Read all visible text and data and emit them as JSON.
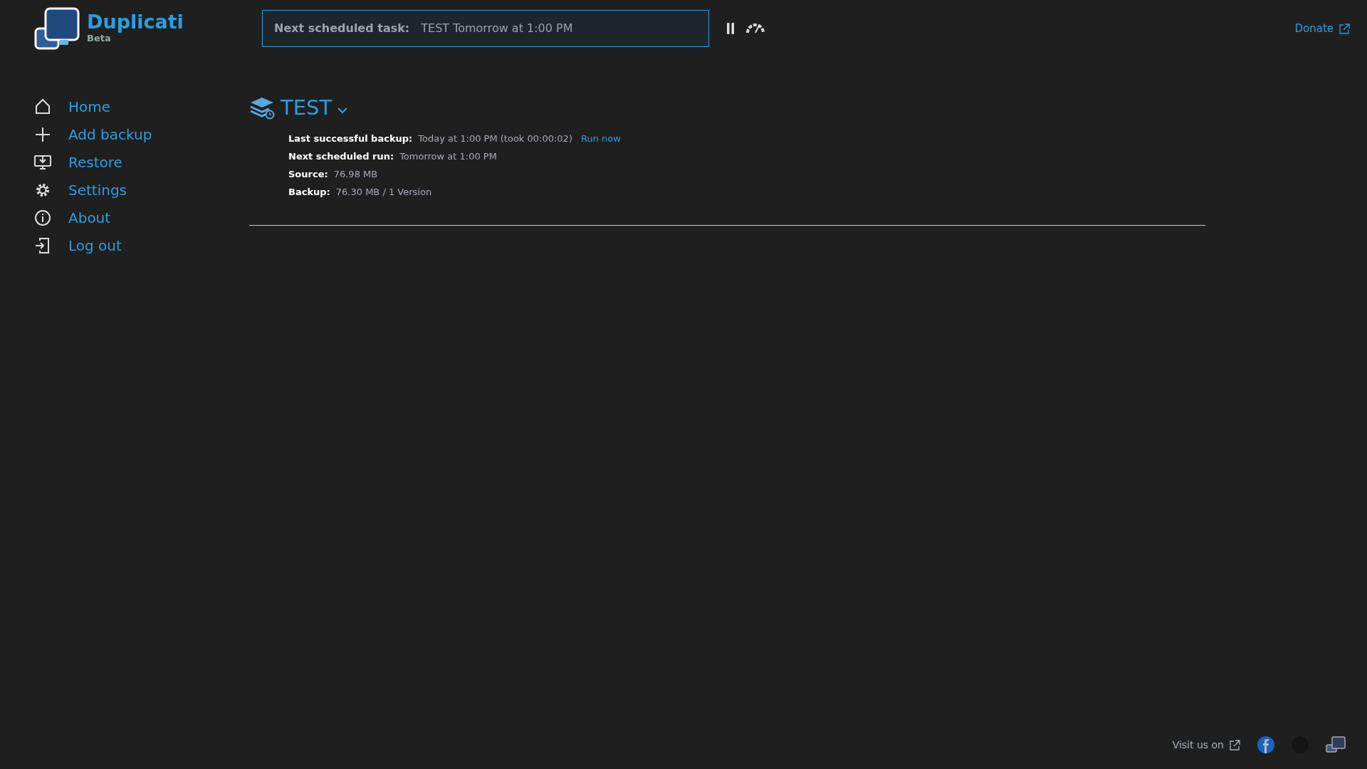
{
  "header": {
    "app_name": "Duplicati",
    "app_edition": "Beta",
    "task_label": "Next scheduled task:",
    "task_value": "TEST Tomorrow at 1:00 PM",
    "donate": "Donate"
  },
  "sidebar": {
    "items": [
      {
        "label": "Home",
        "kind": "home"
      },
      {
        "label": "Add backup",
        "kind": "add"
      },
      {
        "label": "Restore",
        "kind": "restore"
      },
      {
        "label": "Settings",
        "kind": "settings"
      },
      {
        "label": "About",
        "kind": "about"
      },
      {
        "label": "Log out",
        "kind": "logout"
      }
    ]
  },
  "backup": {
    "name": "TEST",
    "details": [
      {
        "label": "Last successful backup:",
        "value": "Today at 1:00 PM (took 00:00:02)",
        "link": "Run now"
      },
      {
        "label": "Next scheduled run:",
        "value": "Tomorrow at 1:00 PM"
      },
      {
        "label": "Source:",
        "value": "76.98 MB"
      },
      {
        "label": "Backup:",
        "value": "76.30 MB / 1 Version"
      }
    ]
  },
  "footer": {
    "text": "Visit us on"
  }
}
